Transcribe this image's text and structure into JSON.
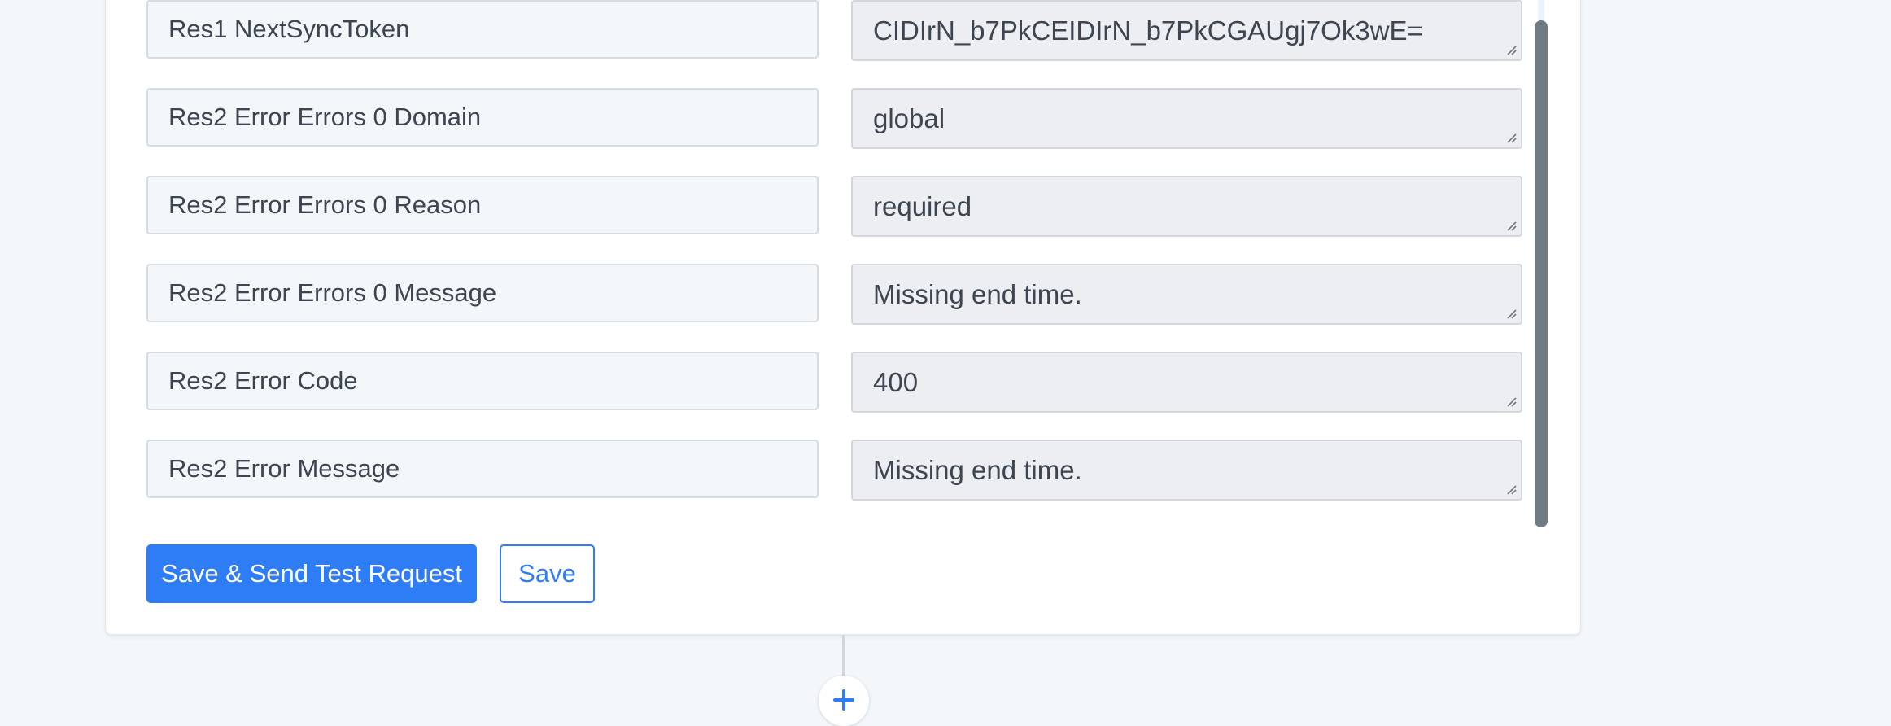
{
  "response_fields": [
    {
      "key": "Res1 NextSyncToken",
      "value": "CIDIrN_b7PkCEIDIrN_b7PkCGAUgj7Ok3wE="
    },
    {
      "key": "Res2 Error Errors 0 Domain",
      "value": "global"
    },
    {
      "key": "Res2 Error Errors 0 Reason",
      "value": "required"
    },
    {
      "key": "Res2 Error Errors 0 Message",
      "value": "Missing end time."
    },
    {
      "key": "Res2 Error Code",
      "value": "400"
    },
    {
      "key": "Res2 Error Message",
      "value": "Missing end time."
    }
  ],
  "actions": {
    "save_and_send_label": "Save & Send Test Request",
    "save_label": "Save"
  },
  "icons": {
    "add_step": "plus-icon",
    "resize": "resize-grip-icon"
  },
  "colors": {
    "primary": "#2e7cf6",
    "page_background": "#f4f7fa",
    "key_field_background": "#f4f7fa",
    "value_field_background": "#eceef1",
    "text": "#3d4550",
    "scrollbar": "#707a82"
  }
}
